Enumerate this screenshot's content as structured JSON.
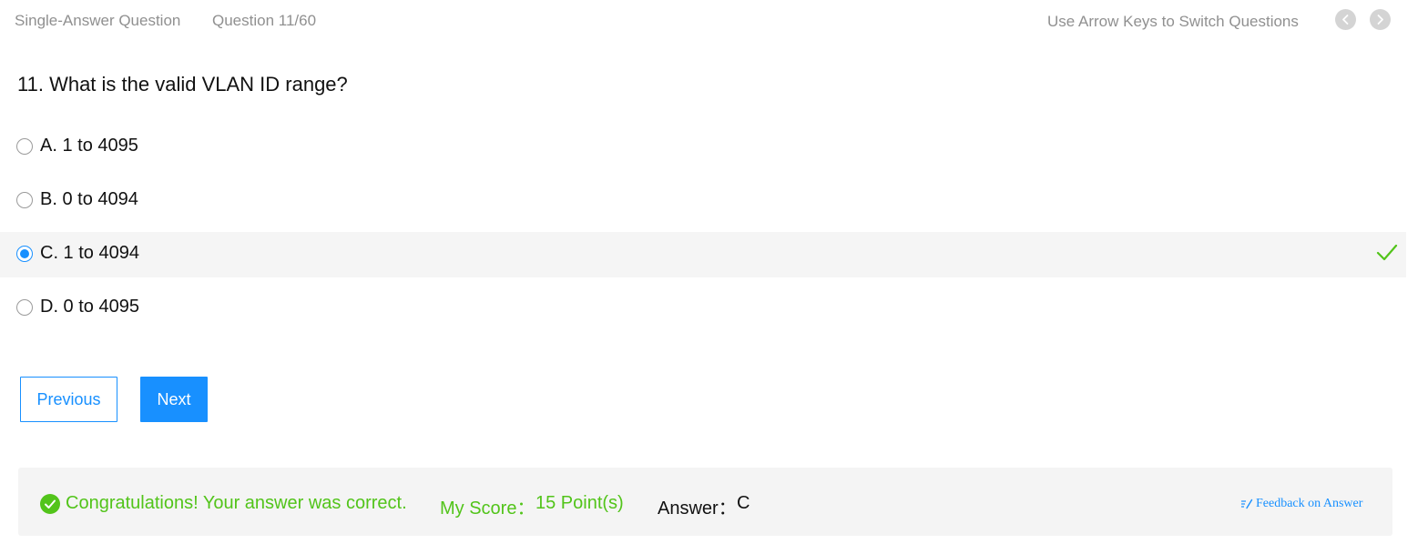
{
  "header": {
    "question_type": "Single-Answer Question",
    "question_counter": "Question 11/60",
    "hint": "Use Arrow Keys to Switch Questions",
    "prev_icon": "chevron-left-icon",
    "next_icon": "chevron-right-icon"
  },
  "question": {
    "stem": "11. What is the valid VLAN ID range?",
    "options": [
      {
        "label": "A. 1 to 4095",
        "selected": false,
        "correct": false
      },
      {
        "label": "B. 0 to 4094",
        "selected": false,
        "correct": false
      },
      {
        "label": "C. 1 to 4094",
        "selected": true,
        "correct": true
      },
      {
        "label": "D. 0 to 4095",
        "selected": false,
        "correct": false
      }
    ]
  },
  "buttons": {
    "previous": "Previous",
    "next": "Next"
  },
  "result": {
    "message": "Congratulations! Your answer was correct.",
    "score_label": "My Score：",
    "score_value": "15 Point(s)",
    "answer_label": "Answer：",
    "answer_value": "C",
    "feedback_link": "Feedback on Answer"
  },
  "colors": {
    "accent": "#1890ff",
    "success": "#52c41a",
    "muted_text": "#909090",
    "selected_row_bg": "#f5f5f5",
    "result_bg": "#f4f4f4"
  }
}
